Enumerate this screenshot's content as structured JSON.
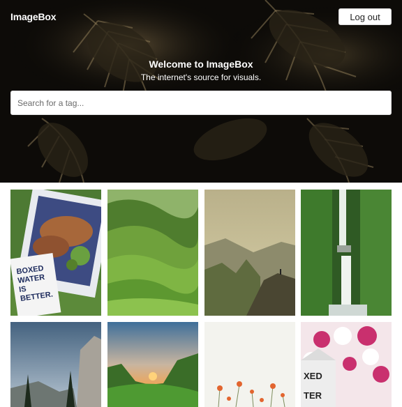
{
  "header": {
    "brand": "ImageBox",
    "logout_label": "Log out"
  },
  "hero": {
    "title": "Welcome to ImageBox",
    "subtitle": "The internet's source for visuals.",
    "search_placeholder": "Search for a tag..."
  },
  "gallery": {
    "photos": [
      {
        "subject": "picnic-box-water-photo",
        "text_lines": [
          "BOXED",
          "WATER",
          "IS",
          "BETTER."
        ]
      },
      {
        "subject": "green-hills-photo"
      },
      {
        "subject": "hiker-on-rock-valley-photo"
      },
      {
        "subject": "waterfall-forest-photo"
      },
      {
        "subject": "cliff-trees-sky-photo"
      },
      {
        "subject": "sunset-valley-photo"
      },
      {
        "subject": "poppy-field-photo"
      },
      {
        "subject": "flowers-water-carton-photo",
        "text_lines": [
          "XED",
          "TER"
        ]
      }
    ]
  },
  "colors": {
    "hero_background": "#0d0b08",
    "button_background": "#ffffff",
    "page_background": "#ffffff"
  }
}
